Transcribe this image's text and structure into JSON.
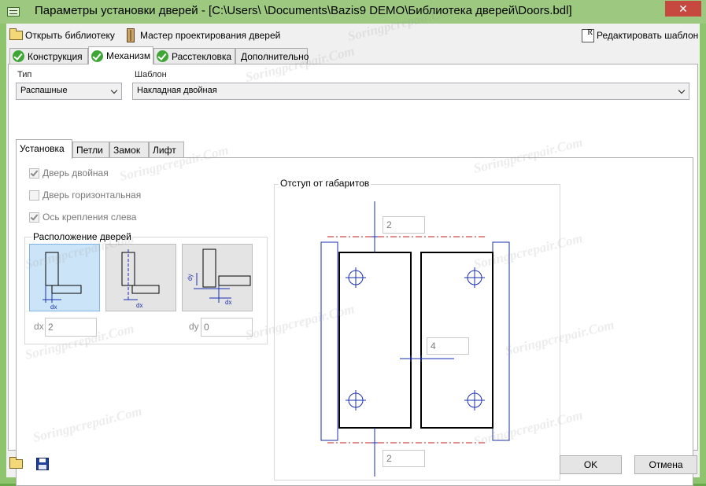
{
  "window": {
    "title": "Параметры установки дверей - [C:\\Users\\          \\Documents\\Bazis9 DEMO\\Библиотека дверей\\Doors.bdl]",
    "close_glyph": "✕"
  },
  "toolbar": {
    "open_library": "Открыть библиотеку",
    "design_wizard": "Мастер проектирования дверей",
    "edit_template": "Редактировать шаблон"
  },
  "main_tabs": [
    {
      "label": "Конструкция",
      "active": false,
      "checked": true
    },
    {
      "label": "Механизм",
      "active": true,
      "checked": true
    },
    {
      "label": "Расстекловка",
      "active": false,
      "checked": true
    },
    {
      "label": "Дополнительно",
      "active": false,
      "checked": false
    }
  ],
  "type_group": {
    "label": "Тип",
    "value": "Распашные"
  },
  "template_group": {
    "label": "Шаблон",
    "value": "Накладная двойная"
  },
  "inner_tabs": [
    {
      "label": "Установка",
      "active": true
    },
    {
      "label": "Петли",
      "active": false
    },
    {
      "label": "Замок",
      "active": false
    },
    {
      "label": "Лифт",
      "active": false
    }
  ],
  "options": {
    "double_door": {
      "label": "Дверь двойная",
      "checked": true
    },
    "horizontal_door": {
      "label": "Дверь горизонтальная",
      "checked": false
    },
    "left_axis": {
      "label": "Ось крепления слева",
      "checked": true
    }
  },
  "placement": {
    "title": "Расположение дверей",
    "selected_index": 0,
    "dx_label": "dx",
    "dy_label": "dy",
    "dx_value": "2",
    "dy_value": "0"
  },
  "scheme": {
    "title": "Отступ от габаритов",
    "top": "2",
    "gap": "4",
    "bottom": "2"
  },
  "buttons": {
    "ok": "OK",
    "cancel": "Отмена"
  },
  "watermark": "Soringpcrepair.Com"
}
